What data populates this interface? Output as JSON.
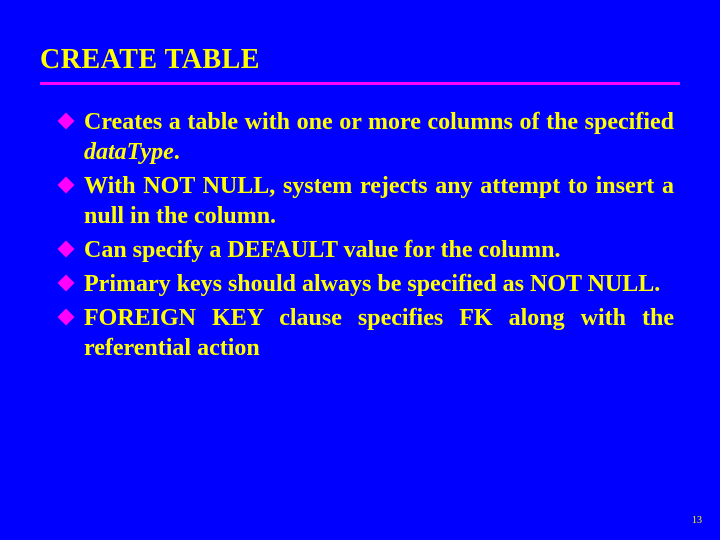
{
  "title": "CREATE TABLE",
  "bullets": [
    {
      "pre": "Creates a table with one or more columns of the specified ",
      "em": "dataType",
      "post": "."
    },
    {
      "pre": "With NOT NULL, system rejects any attempt to insert a null in the column.",
      "em": "",
      "post": ""
    },
    {
      "pre": "Can specify a DEFAULT value for the column.",
      "em": "",
      "post": ""
    },
    {
      "pre": "Primary keys should always be specified as NOT NULL.",
      "em": "",
      "post": ""
    },
    {
      "pre": "FOREIGN KEY clause specifies FK along with the referential action",
      "em": "",
      "post": ""
    }
  ],
  "pagenum": "13"
}
